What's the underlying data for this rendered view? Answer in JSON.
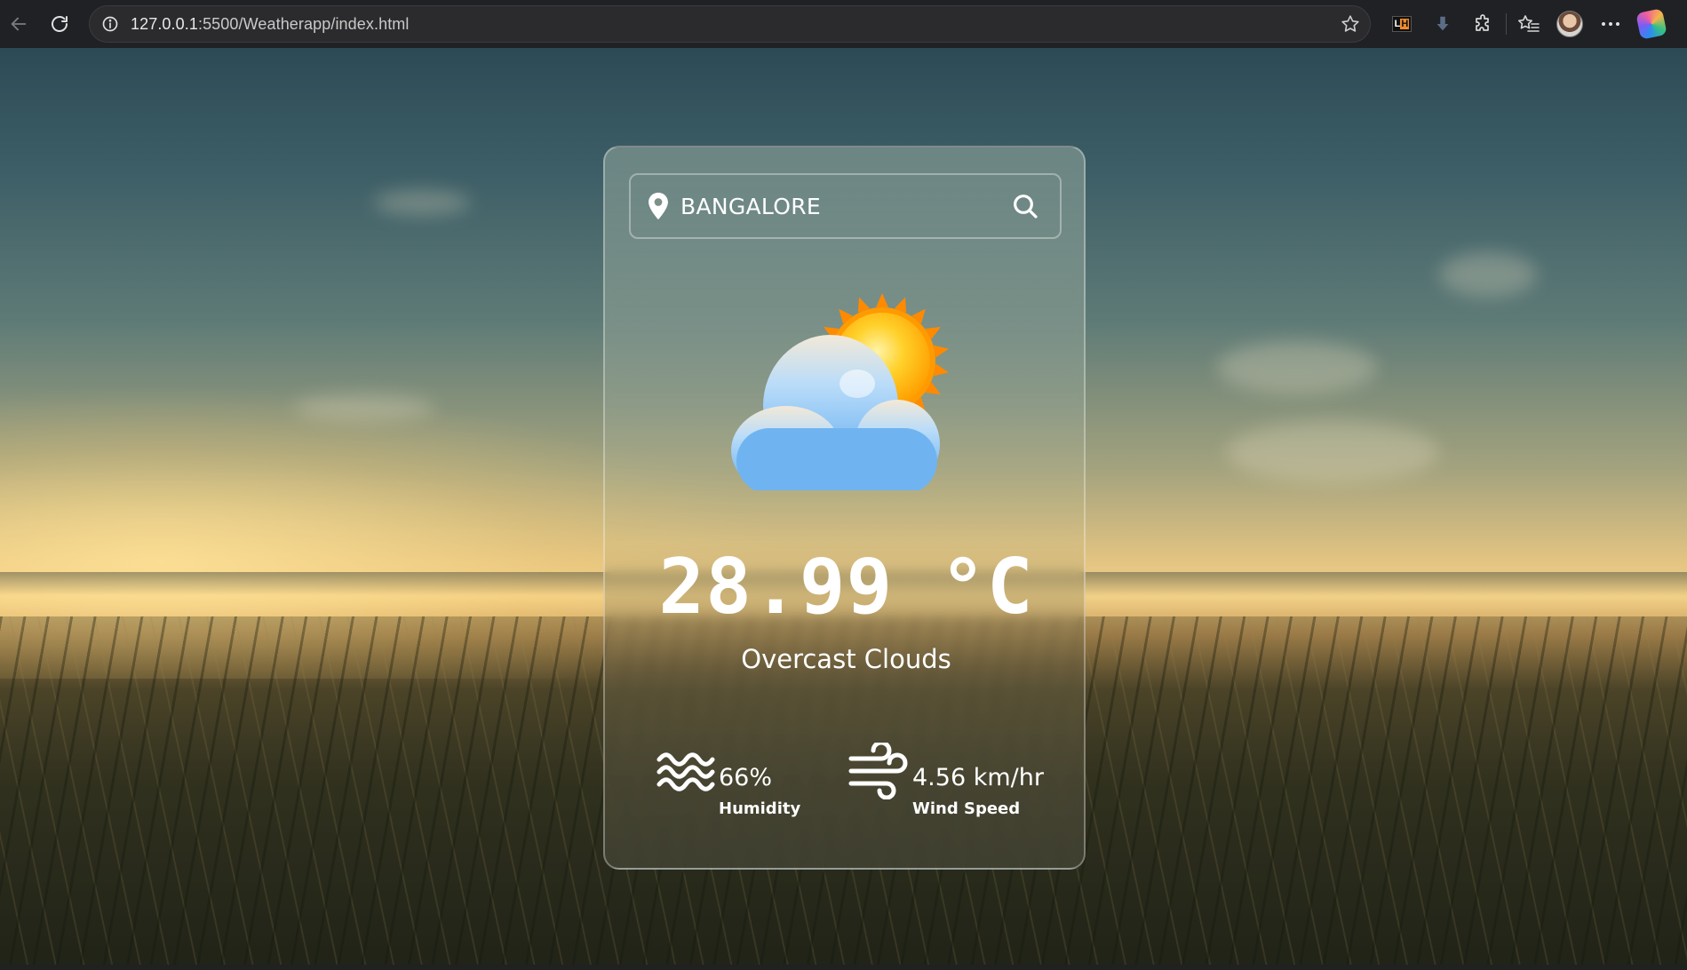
{
  "browser": {
    "url_host": "127.0.0.1",
    "url_rest": ":5500/Weatherapp/index.html",
    "extension_badge": {
      "left": "L",
      "right": "H"
    }
  },
  "search": {
    "city_value": "BANGALORE"
  },
  "weather": {
    "condition_icon": "cloud-sun-icon",
    "temperature": "28.99 °C",
    "description": "Overcast Clouds"
  },
  "details": {
    "humidity": {
      "value": "66%",
      "label": "Humidity",
      "icon": "waves-icon"
    },
    "wind": {
      "value": "4.56 km/hr",
      "label": "Wind Speed",
      "icon": "wind-icon"
    }
  },
  "colors": {
    "text": "#ffffff",
    "sun_core": "#ffc21c",
    "sun_rays": "#ff8a00",
    "cloud_light": "#e6f3ff",
    "cloud_dark": "#5aa8ef"
  }
}
